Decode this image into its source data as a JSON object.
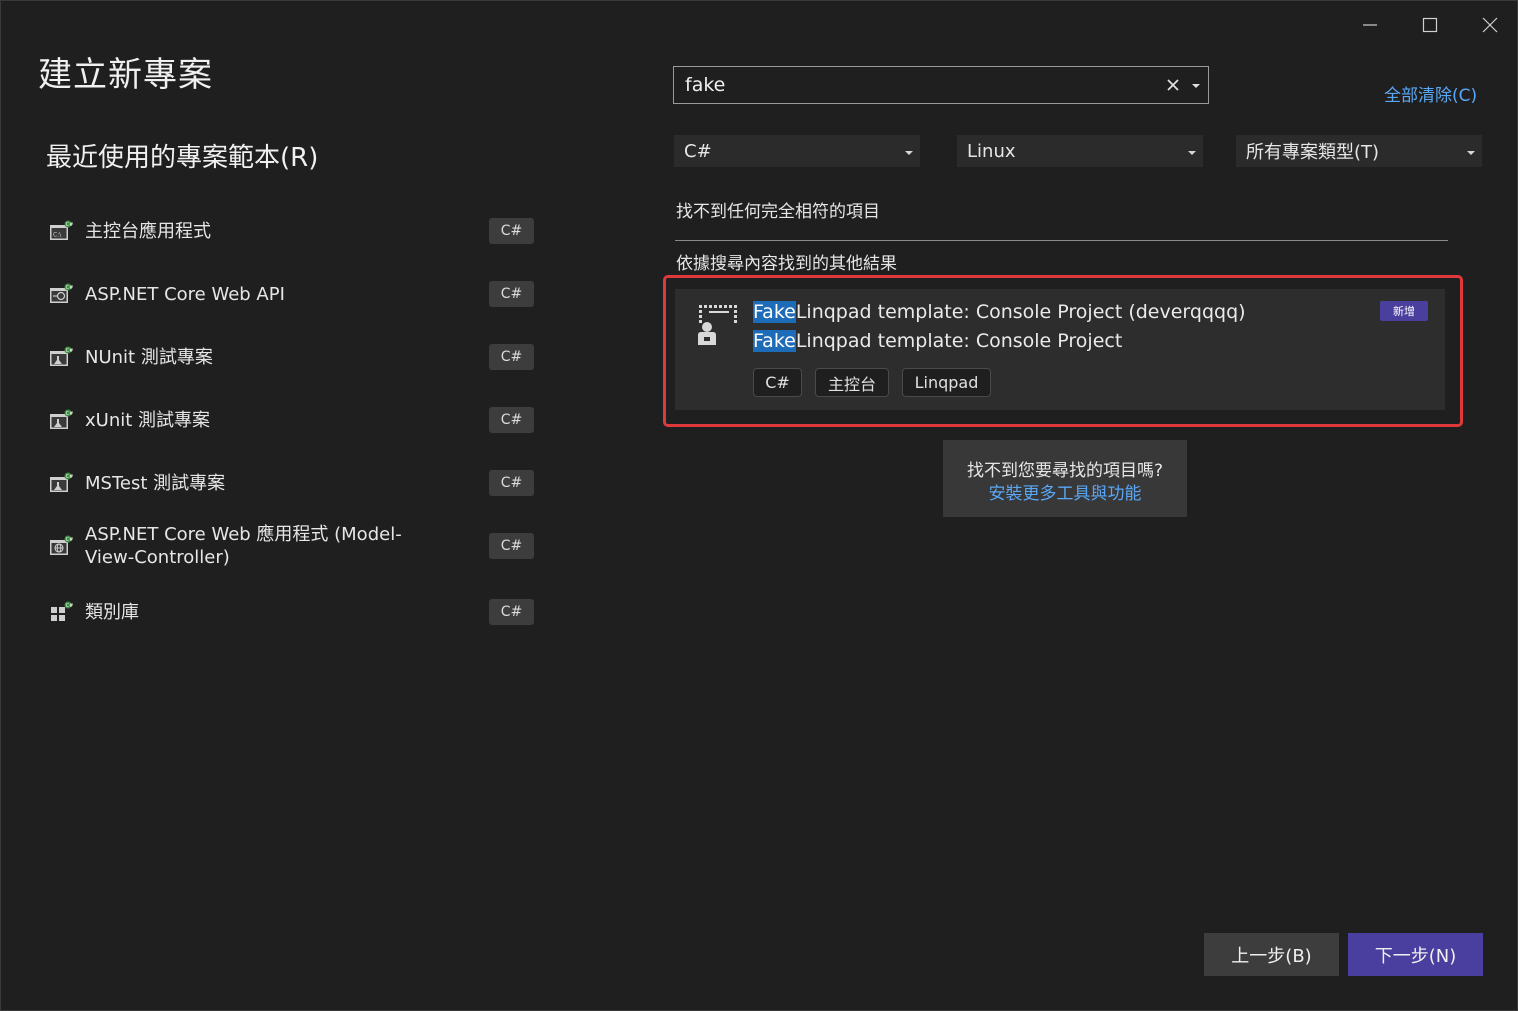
{
  "window": {
    "title": "建立新專案",
    "minimize_icon": "minimize-icon",
    "maximize_icon": "maximize-icon",
    "close_icon": "close-icon"
  },
  "recent": {
    "heading": "最近使用的專案範本(R)",
    "items": [
      {
        "name": "主控台應用程式",
        "lang": "C#",
        "icon": "console-app-icon"
      },
      {
        "name": "ASP.NET Core Web API",
        "lang": "C#",
        "icon": "web-api-icon"
      },
      {
        "name": "NUnit 測試專案",
        "lang": "C#",
        "icon": "test-project-icon"
      },
      {
        "name": "xUnit 測試專案",
        "lang": "C#",
        "icon": "test-project-icon"
      },
      {
        "name": "MSTest 測試專案",
        "lang": "C#",
        "icon": "test-project-icon"
      },
      {
        "name": "ASP.NET Core Web 應用程式 (Model-View-Controller)",
        "lang": "C#",
        "icon": "web-app-icon"
      },
      {
        "name": "類別庫",
        "lang": "C#",
        "icon": "class-library-icon"
      }
    ]
  },
  "search": {
    "value": "fake",
    "clear_all": "全部清除(C)"
  },
  "filters": {
    "language": "C#",
    "platform": "Linux",
    "project_type": "所有專案類型(T)"
  },
  "results": {
    "no_exact_match": "找不到任何完全相符的項目",
    "other_results_heading": "依據搜尋內容找到的其他結果",
    "card": {
      "title_highlight": "Fake",
      "title_rest": "Linqpad template: Console Project (deverqqqq)",
      "subtitle_highlight": "Fake",
      "subtitle_rest": "Linqpad template: Console Project",
      "badge": "新增",
      "tags": [
        "C#",
        "主控台",
        "Linqpad"
      ]
    }
  },
  "help": {
    "question": "找不到您要尋找的項目嗎?",
    "link": "安裝更多工具與功能"
  },
  "footer": {
    "back": "上一步(B)",
    "next": "下一步(N)"
  },
  "colors": {
    "accent": "#4a3f9e",
    "link": "#5aa7f5",
    "highlight": "#1e6bb8",
    "frame": "#e0393b"
  }
}
